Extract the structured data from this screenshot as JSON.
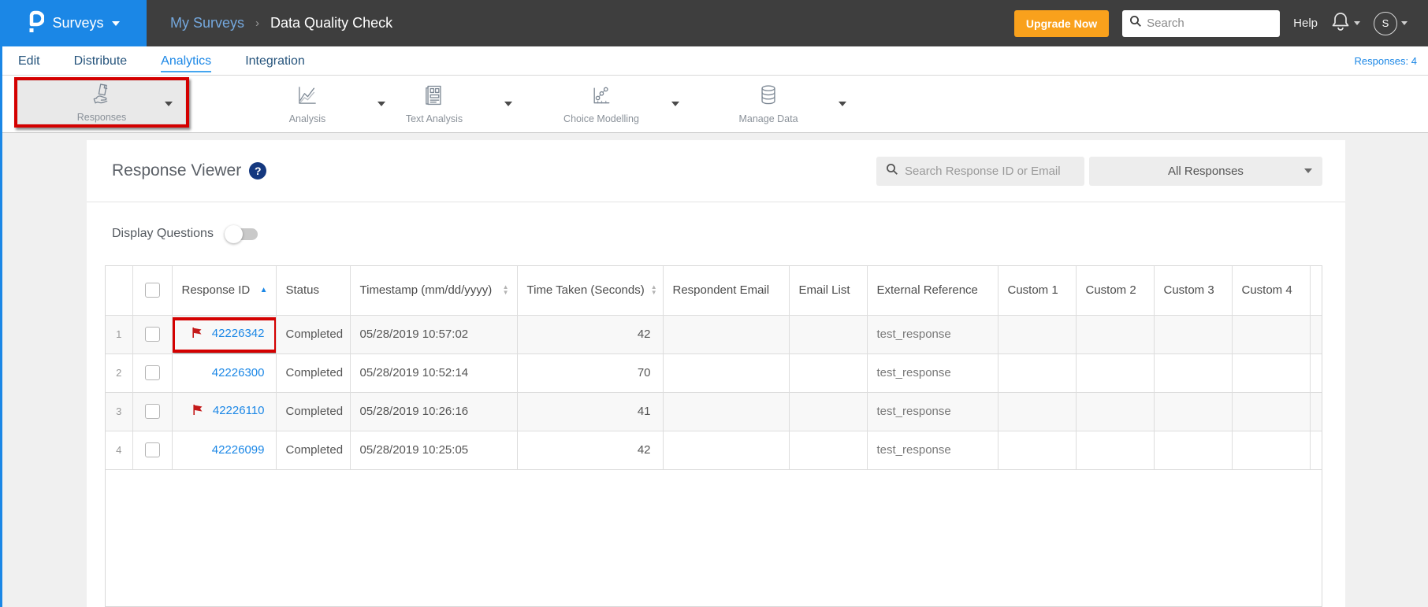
{
  "colors": {
    "accent_blue": "#1b87e6",
    "topbar_bg": "#3e3e3e",
    "upgrade_orange": "#f9a11c",
    "annotation_red": "#d40000",
    "flag_red": "#c41a1a",
    "help_badge_navy": "#14387f",
    "active_tool_bg": "#e9e9e9"
  },
  "topbar": {
    "product": "Surveys",
    "breadcrumb": {
      "parent": "My Surveys",
      "separator": "›",
      "current": "Data Quality Check"
    },
    "upgrade_label": "Upgrade Now",
    "search_placeholder": "Search",
    "help_label": "Help",
    "avatar_initial": "S"
  },
  "nav": {
    "items": [
      "Edit",
      "Distribute",
      "Analytics",
      "Integration"
    ],
    "active": "Analytics",
    "responses_count": "Responses: 4"
  },
  "toolbar": {
    "items": [
      {
        "label": "Responses",
        "icon": "responses-icon",
        "active": true,
        "annotated": true
      },
      {
        "label": "Analysis",
        "icon": "analysis-icon",
        "active": false
      },
      {
        "label": "Text Analysis",
        "icon": "text-analysis-icon",
        "active": false
      },
      {
        "label": "Choice Modelling",
        "icon": "choice-modelling-icon",
        "active": false
      },
      {
        "label": "Manage Data",
        "icon": "manage-data-icon",
        "active": false
      }
    ]
  },
  "viewer": {
    "title": "Response Viewer",
    "help_icon": "?",
    "search_placeholder": "Search Response ID or Email",
    "filter_value": "All Responses",
    "display_questions_label": "Display Questions",
    "display_questions_on": false
  },
  "table": {
    "columns": [
      {
        "key": "row_num",
        "label": "",
        "sort": null
      },
      {
        "key": "checkbox",
        "label": "",
        "sort": null
      },
      {
        "key": "response_id",
        "label": "Response ID",
        "sort": "asc"
      },
      {
        "key": "status",
        "label": "Status",
        "sort": null
      },
      {
        "key": "timestamp",
        "label": "Timestamp (mm/dd/yyyy)",
        "sort": "both"
      },
      {
        "key": "time_taken",
        "label": "Time Taken (Seconds)",
        "sort": "both"
      },
      {
        "key": "respondent_email",
        "label": "Respondent Email",
        "sort": null
      },
      {
        "key": "email_list",
        "label": "Email List",
        "sort": null
      },
      {
        "key": "external_reference",
        "label": "External Reference",
        "sort": null
      },
      {
        "key": "custom1",
        "label": "Custom 1",
        "sort": null
      },
      {
        "key": "custom2",
        "label": "Custom 2",
        "sort": null
      },
      {
        "key": "custom3",
        "label": "Custom 3",
        "sort": null
      },
      {
        "key": "custom4",
        "label": "Custom 4",
        "sort": null
      },
      {
        "key": "spacer",
        "label": "",
        "sort": null
      }
    ],
    "rows": [
      {
        "num": "1",
        "response_id": "42226342",
        "flagged": true,
        "annotated": true,
        "status": "Completed",
        "timestamp": "05/28/2019 10:57:02",
        "time_taken": "42",
        "respondent_email": "",
        "email_list": "",
        "external_reference": "test_response",
        "custom1": "",
        "custom2": "",
        "custom3": "",
        "custom4": ""
      },
      {
        "num": "2",
        "response_id": "42226300",
        "flagged": false,
        "annotated": false,
        "status": "Completed",
        "timestamp": "05/28/2019 10:52:14",
        "time_taken": "70",
        "respondent_email": "",
        "email_list": "",
        "external_reference": "test_response",
        "custom1": "",
        "custom2": "",
        "custom3": "",
        "custom4": ""
      },
      {
        "num": "3",
        "response_id": "42226110",
        "flagged": true,
        "annotated": false,
        "status": "Completed",
        "timestamp": "05/28/2019 10:26:16",
        "time_taken": "41",
        "respondent_email": "",
        "email_list": "",
        "external_reference": "test_response",
        "custom1": "",
        "custom2": "",
        "custom3": "",
        "custom4": ""
      },
      {
        "num": "4",
        "response_id": "42226099",
        "flagged": false,
        "annotated": false,
        "status": "Completed",
        "timestamp": "05/28/2019 10:25:05",
        "time_taken": "42",
        "respondent_email": "",
        "email_list": "",
        "external_reference": "test_response",
        "custom1": "",
        "custom2": "",
        "custom3": "",
        "custom4": ""
      }
    ]
  }
}
